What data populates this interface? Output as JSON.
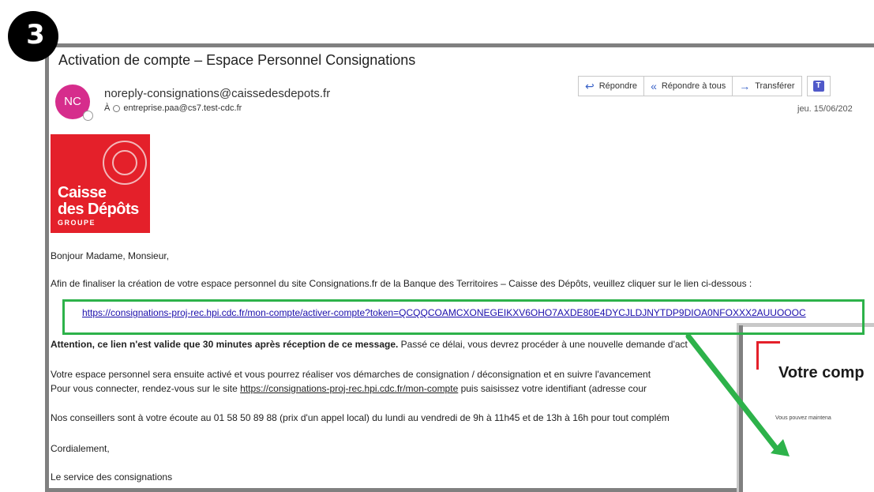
{
  "step": "3",
  "email": {
    "subject": "Activation de compte – Espace Personnel Consignations",
    "avatar_initials": "NC",
    "sender": "noreply-consignations@caissedesdepots.fr",
    "to_label": "À",
    "recipient": "entreprise.paa@cs7.test-cdc.fr",
    "date": "jeu. 15/06/202",
    "actions": {
      "reply": "Répondre",
      "reply_all": "Répondre à tous",
      "forward": "Transférer"
    },
    "logo": {
      "line1": "Caisse",
      "line2": "des Dépôts",
      "line3": "GROUPE"
    },
    "greeting": "Bonjour Madame, Monsieur,",
    "intro": "Afin de finaliser la création de votre espace personnel du site Consignations.fr de la Banque des Territoires – Caisse des Dépôts, veuillez cliquer sur le lien ci-dessous :",
    "activation_link": "https://consignations-proj-rec.hpi.cdc.fr/mon-compte/activer-compte?token=QCQQCOAMCXONEGEIKXV6OHO7AXDE80E4DYCJLDJNYTDP9DIOA0NFOXXX2AUUOOOC",
    "warning_bold": "Attention, ce lien n'est valide que 30 minutes après réception de ce message.",
    "warning_rest": " Passé ce délai, vous devrez procéder à une nouvelle demande d'act",
    "activation_line1": "Votre espace personnel sera ensuite activé et vous pourrez réaliser vos démarches de consignation / déconsignation et en suivre l'avancement",
    "activation_line2_pre": "Pour vous connecter, rendez-vous sur le site ",
    "activation_line2_link": "https://consignations-proj-rec.hpi.cdc.fr/mon-compte",
    "activation_line2_post": " puis saisissez votre identifiant (adresse cour",
    "advisors": "Nos conseillers sont à votre écoute au 01 58 50 89 88 (prix d'un appel local) du lundi au vendredi de 9h à 11h45 et de 13h à 16h pour tout complém",
    "closing": "Cordialement,",
    "signature": "Le service des consignations"
  },
  "confirmation": {
    "title": "Votre comp",
    "subtitle": "Vous pouvez maintena"
  },
  "colors": {
    "brand_red": "#e4202a",
    "avatar_pink": "#d62d8c",
    "highlight_green": "#2db24a",
    "link_blue": "#1a0dab"
  }
}
